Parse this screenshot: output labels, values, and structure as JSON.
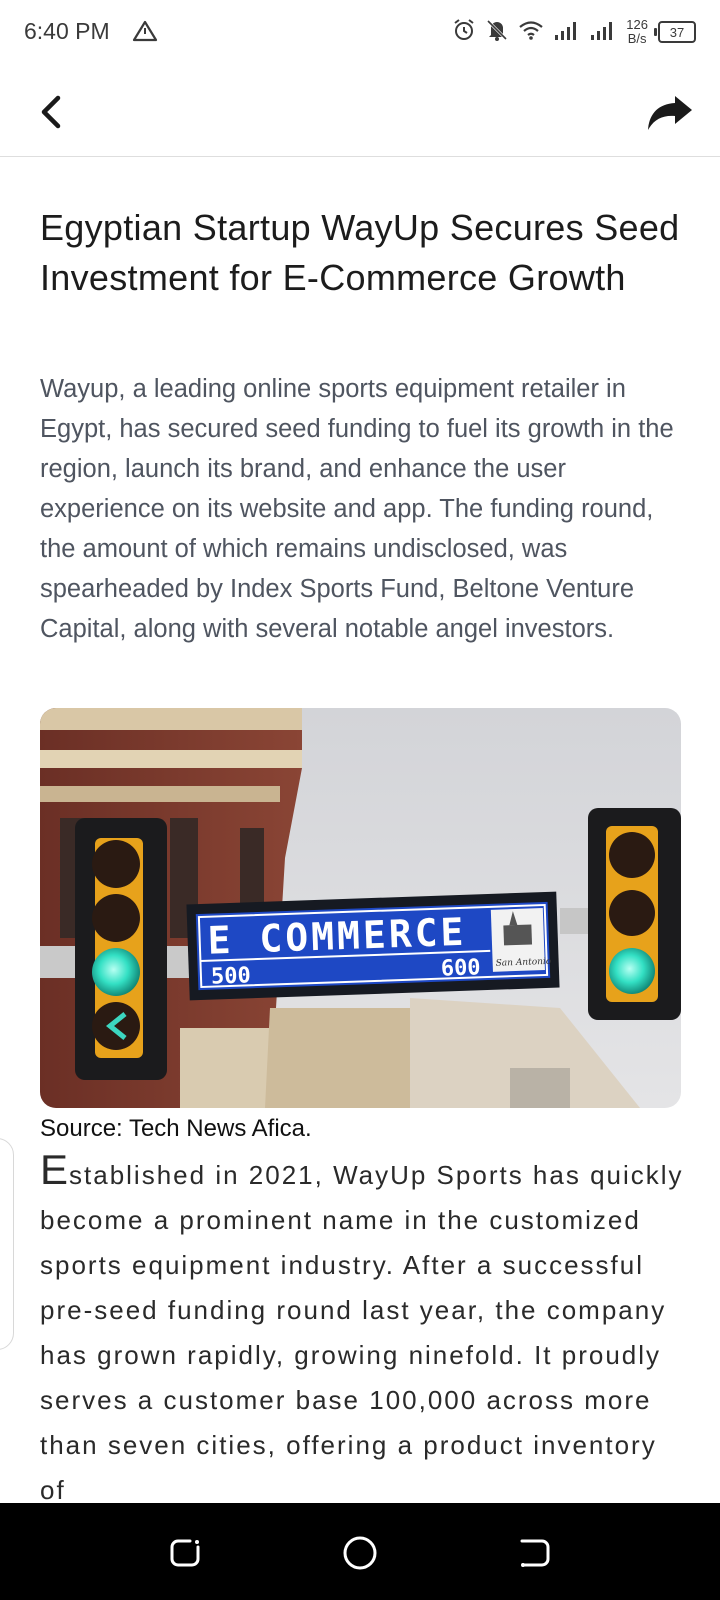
{
  "status_bar": {
    "time": "6:40 PM",
    "net_speed_value": "126",
    "net_speed_unit": "B/s",
    "battery": "37",
    "icons": [
      "warning-icon",
      "alarm-icon",
      "bell-off-icon",
      "wifi-icon",
      "signal-icon",
      "signal-icon"
    ]
  },
  "header": {
    "back_icon": "chevron-left-icon",
    "share_icon": "share-arrow-icon"
  },
  "article": {
    "title": "Egyptian Startup WayUp Secures Seed Investment for E-Commerce Growth",
    "summary": "Wayup, a leading online sports equipment retailer in Egypt, has secured seed funding to fuel its growth in the region, launch its brand, and enhance the user experience on its website and app.  The funding round, the amount of which remains undisclosed, was spearheaded by Index Sports Fund, Beltone Venture Capital, along with several notable angel investors.",
    "image": {
      "sign_text": "E COMMERCE",
      "sign_left_number": "500",
      "sign_right_number": "600",
      "sign_badge": "San Antonio"
    },
    "image_caption": "Source: Tech News Afica.",
    "body_dropcap": "E",
    "body_text": "stablished in 2021, WayUp Sports has quickly become a prominent name in the customized sports equipment industry. After a successful pre-seed funding round last year, the company has grown rapidly, growing ninefold.  It proudly serves a customer base 100,000 across more than seven cities, offering a product inventory of"
  },
  "nav_bar": {
    "buttons": [
      "recent-apps-icon",
      "home-icon",
      "back-gesture-icon"
    ]
  }
}
